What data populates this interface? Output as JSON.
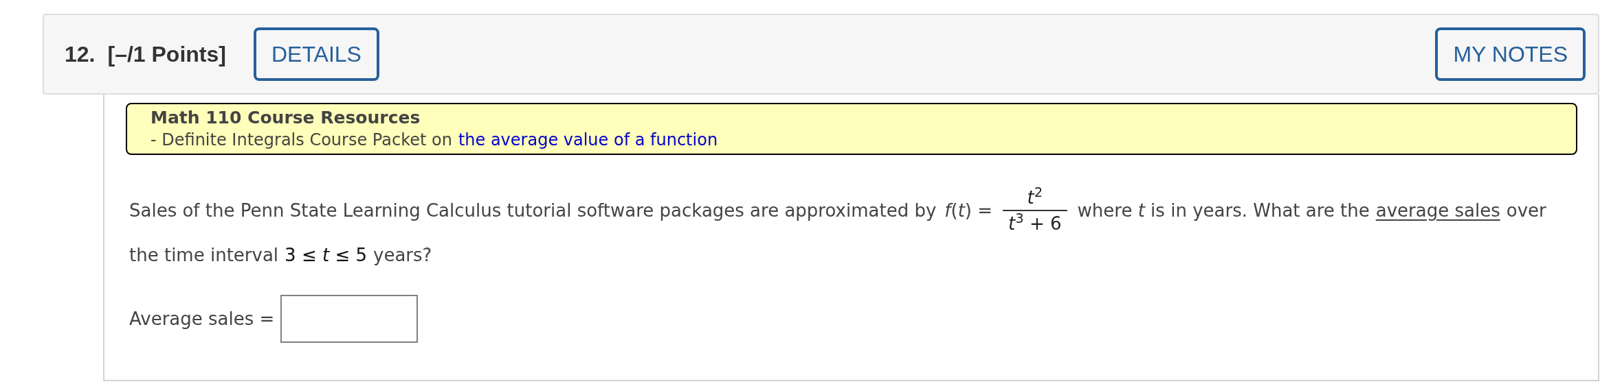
{
  "header": {
    "number": "12.",
    "points": "[–/1 Points]",
    "buttons": [
      {
        "label": "DETAILS"
      },
      {
        "label": "MY NOTES"
      }
    ]
  },
  "resources": {
    "title": "Math 110 Course Resources",
    "line_prefix": "- Definite Integrals Course Packet on",
    "link": "the average value of a function"
  },
  "question": {
    "line1_text": "Sales of the Penn State Learning Calculus tutorial software packages are approximated by",
    "function_lhs": "*f*(*t*) =",
    "numerator": "*t*$^{2}$",
    "denominator": "*t*$^{3}$ + 6",
    "after_fraction": "where *t* is in years. What are the",
    "glossary_link": "average sales",
    "line1_end": "over",
    "line2_text": "the time interval",
    "line2_math": "3 ≤ *t* ≤ 5",
    "line2_end": "years?"
  },
  "answer": {
    "label": "Average sales ="
  }
}
